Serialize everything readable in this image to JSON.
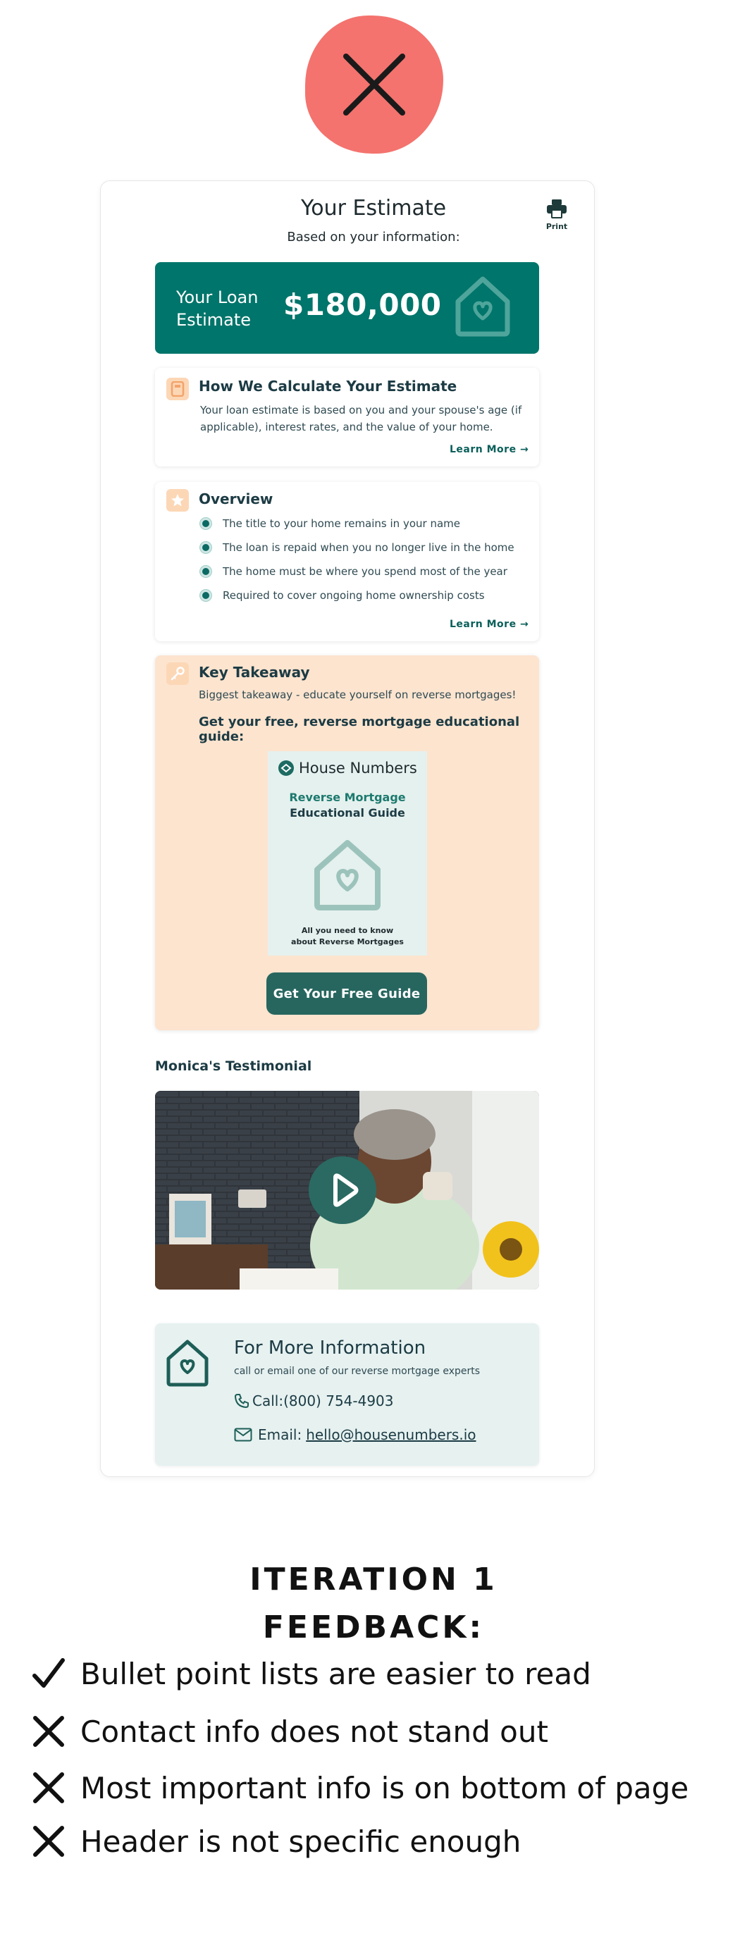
{
  "header": {
    "title": "Your Estimate",
    "subtitle": "Based on your information:",
    "print_label": "Print"
  },
  "loan": {
    "label": "Your Loan Estimate",
    "amount": "$180,000"
  },
  "calc_card": {
    "title": "How We Calculate Your Estimate",
    "body": "Your loan estimate is based on you and your spouse's age (if applicable), interest rates, and the value of your home.",
    "learn_more": "Learn More"
  },
  "overview_card": {
    "title": "Overview",
    "items": [
      "The title to your home remains in your name",
      "The loan is repaid when you no longer live in the home",
      "The home must be where you spend most of the year",
      "Required to cover ongoing home ownership costs"
    ],
    "learn_more": "Learn More"
  },
  "takeaway_card": {
    "title": "Key Takeaway",
    "subtitle": "Biggest takeaway - educate yourself on reverse mortgages!",
    "cta_heading": "Get your free, reverse mortgage educational guide:",
    "guide": {
      "brand": "House Numbers",
      "line1": "Reverse Mortgage",
      "line2": "Educational Guide",
      "foot1": "All you need to know",
      "foot2": "about Reverse Mortgages"
    },
    "button": "Get Your Free Guide"
  },
  "testimonial": {
    "title": "Monica's Testimonial"
  },
  "contact": {
    "title": "For More Information",
    "subtitle": "call or email one of our reverse mortgage experts",
    "call_label": "Call:",
    "phone": "(800) 754-4903",
    "email_label": "Email:",
    "email": "hello@housenumbers.io"
  },
  "feedback": {
    "heading_line1": "ITERATION 1",
    "heading_line2": "FEEDBACK:",
    "items": [
      {
        "mark": "check",
        "text": "Bullet point lists are easier to read"
      },
      {
        "mark": "cross",
        "text": "Contact info does not stand out"
      },
      {
        "mark": "cross",
        "text": "Most important info is on bottom of page"
      },
      {
        "mark": "cross",
        "text": "Header is not specific enough"
      }
    ]
  },
  "colors": {
    "teal": "#00756b",
    "peach": "#fde4cf",
    "badge_red": "#f4736e",
    "contact_bg": "#e6f1f0"
  }
}
